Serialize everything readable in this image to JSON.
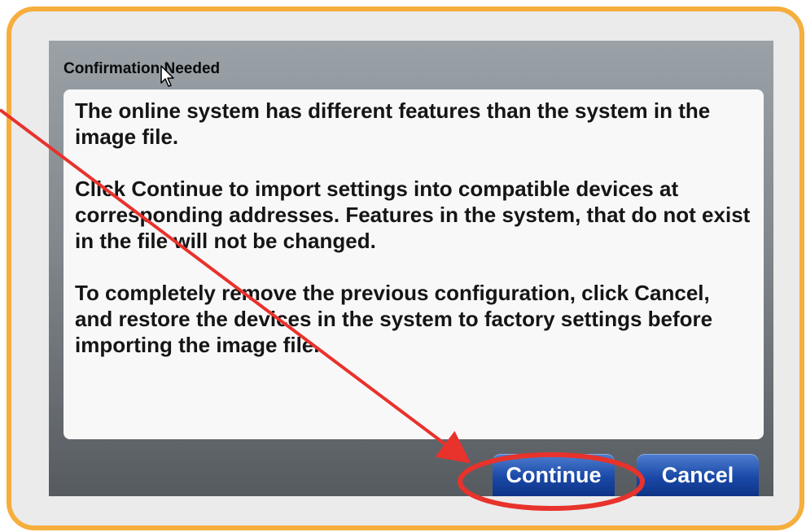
{
  "dialog": {
    "title": "Confirmation Needed",
    "message": {
      "p1": "The online system has different features than the system in the image file.",
      "p2": "Click Continue to import settings into compatible devices at corresponding addresses. Features in the system, that do not exist in the file will not be changed.",
      "p3": "To completely remove the previous configuration, click Cancel, and restore the devices in the system to factory settings before importing the image file."
    },
    "buttons": {
      "continue_label": "Continue",
      "cancel_label": "Cancel"
    }
  },
  "colors": {
    "frame_border": "#f6ae3c",
    "annotation_red": "#e8322c",
    "button_blue": "#1a49a8"
  },
  "icons": [
    "mouse-pointer-icon",
    "annotation-arrow",
    "annotation-circle"
  ]
}
